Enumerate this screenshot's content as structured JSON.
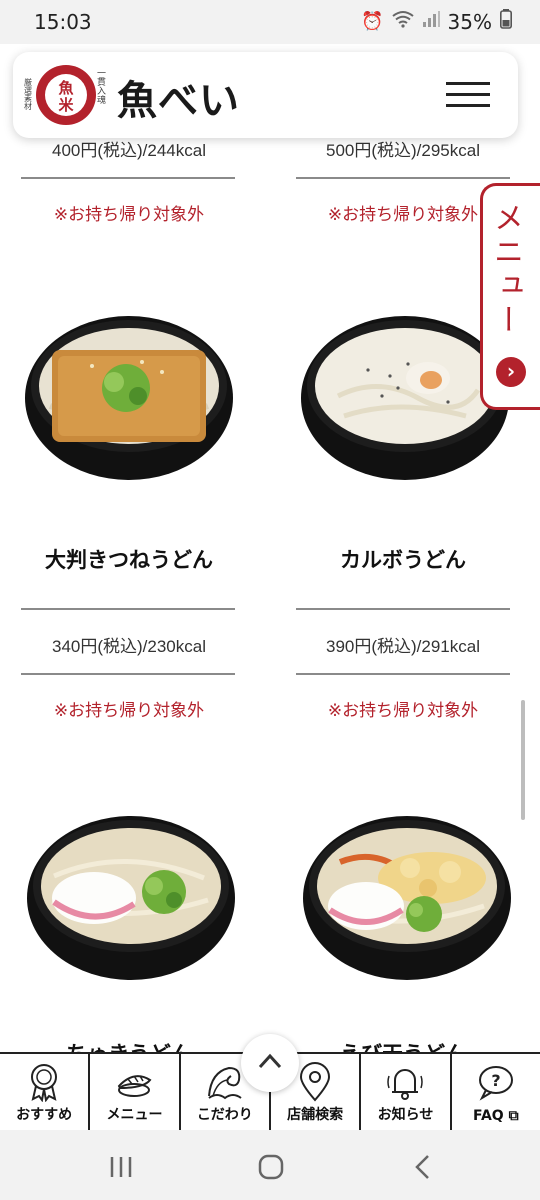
{
  "status": {
    "time": "15:03",
    "battery": "35%"
  },
  "header": {
    "logo_emblem_chars": [
      "魚",
      "米"
    ],
    "logo_side_text_right": "一貫入魂",
    "logo_side_text_left": "厳選素材",
    "logo_text": "魚べい"
  },
  "side_tab": {
    "label": "メニュー"
  },
  "products": [
    {
      "price": "400円(税込)/244kcal",
      "note": "※お持ち帰り対象外"
    },
    {
      "price": "500円(税込)/295kcal",
      "note": "※お持ち帰り対象外"
    },
    {
      "name": "大判きつねうどん",
      "price": "340円(税込)/230kcal",
      "note": "※お持ち帰り対象外"
    },
    {
      "name": "カルボうどん",
      "price": "390円(税込)/291kcal",
      "note": "※お持ち帰り対象外"
    },
    {
      "name": "ちゅきうどん"
    },
    {
      "name": "えび天うどん"
    }
  ],
  "bottom_nav": [
    {
      "label": "おすすめ",
      "icon": "medal-icon"
    },
    {
      "label": "メニュー",
      "icon": "sushi-icon"
    },
    {
      "label": "こだわり",
      "icon": "wave-icon"
    },
    {
      "label": "店舗検索",
      "icon": "map-pin-icon"
    },
    {
      "label": "お知らせ",
      "icon": "bell-icon"
    },
    {
      "label": "FAQ",
      "icon": "question-bubble-icon"
    }
  ],
  "colors": {
    "accent": "#b3222c",
    "text": "#222222",
    "rule": "#8a8a8a"
  }
}
